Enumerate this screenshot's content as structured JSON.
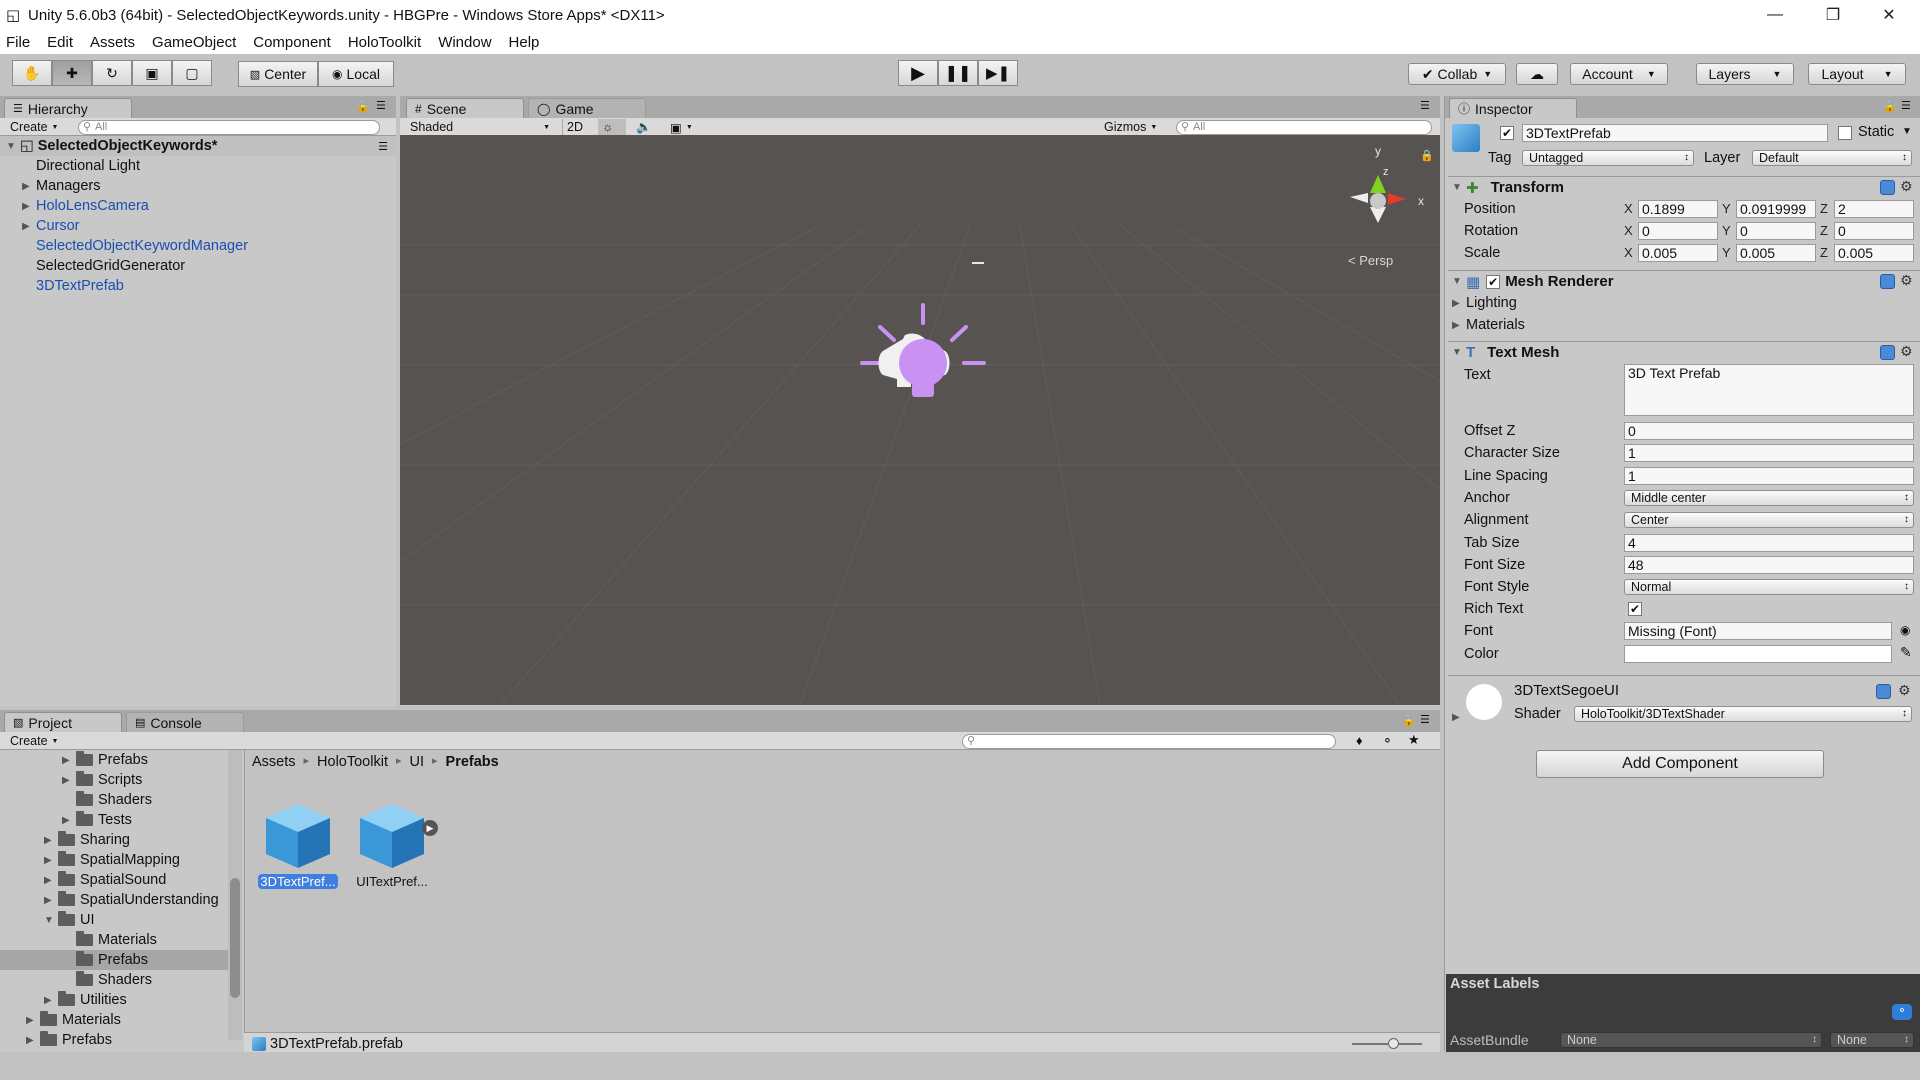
{
  "window": {
    "title": "Unity 5.6.0b3 (64bit) - SelectedObjectKeywords.unity - HBGPre - Windows Store Apps* <DX11>"
  },
  "menu": [
    "File",
    "Edit",
    "Assets",
    "GameObject",
    "Component",
    "HoloToolkit",
    "Window",
    "Help"
  ],
  "toolbar": {
    "pivot": "Center",
    "space": "Local",
    "collab": "Collab",
    "account": "Account",
    "layers": "Layers",
    "layout": "Layout"
  },
  "hierarchy": {
    "tab": "Hierarchy",
    "create": "Create",
    "search_placeholder": "All",
    "scene_name": "SelectedObjectKeywords*",
    "items": [
      {
        "label": "Directional Light",
        "expandable": false,
        "prefab": false
      },
      {
        "label": "Managers",
        "expandable": true,
        "prefab": false
      },
      {
        "label": "HoloLensCamera",
        "expandable": true,
        "prefab": true
      },
      {
        "label": "Cursor",
        "expandable": true,
        "prefab": true
      },
      {
        "label": "SelectedObjectKeywordManager",
        "expandable": false,
        "prefab": true
      },
      {
        "label": "SelectedGridGenerator",
        "expandable": false,
        "prefab": false
      },
      {
        "label": "3DTextPrefab",
        "expandable": false,
        "prefab": true
      }
    ]
  },
  "scene": {
    "tab_scene": "Scene",
    "tab_game": "Game",
    "shading": "Shaded",
    "mode_2d": "2D",
    "gizmos": "Gizmos",
    "search_placeholder": "All",
    "persp": "Persp",
    "axis_x": "x",
    "axis_y": "y",
    "axis_z": "z"
  },
  "inspector": {
    "tab": "Inspector",
    "object_name": "3DTextPrefab",
    "static_label": "Static",
    "tag_label": "Tag",
    "tag_value": "Untagged",
    "layer_label": "Layer",
    "layer_value": "Default",
    "transform": {
      "title": "Transform",
      "rows": [
        {
          "label": "Position",
          "x": "0.1899",
          "y": "0.0919999",
          "z": "2"
        },
        {
          "label": "Rotation",
          "x": "0",
          "y": "0",
          "z": "0"
        },
        {
          "label": "Scale",
          "x": "0.005",
          "y": "0.005",
          "z": "0.005"
        }
      ]
    },
    "mesh_renderer": {
      "title": "Mesh Renderer",
      "lighting": "Lighting",
      "materials": "Materials"
    },
    "text_mesh": {
      "title": "Text Mesh",
      "text_label": "Text",
      "text_value": "3D Text Prefab",
      "rows": [
        {
          "label": "Offset Z",
          "value": "0",
          "kind": "field"
        },
        {
          "label": "Character Size",
          "value": "1",
          "kind": "field"
        },
        {
          "label": "Line Spacing",
          "value": "1",
          "kind": "field"
        },
        {
          "label": "Anchor",
          "value": "Middle center",
          "kind": "popup"
        },
        {
          "label": "Alignment",
          "value": "Center",
          "kind": "popup"
        },
        {
          "label": "Tab Size",
          "value": "4",
          "kind": "field"
        },
        {
          "label": "Font Size",
          "value": "48",
          "kind": "field"
        },
        {
          "label": "Font Style",
          "value": "Normal",
          "kind": "popup"
        }
      ],
      "rich_text_label": "Rich Text",
      "rich_text": true,
      "font_label": "Font",
      "font_value": "Missing (Font)",
      "color_label": "Color",
      "color_value": "#ffffff"
    },
    "material": {
      "name": "3DTextSegoeUI",
      "shader_label": "Shader",
      "shader_value": "HoloToolkit/3DTextShader"
    },
    "add_component": "Add Component",
    "asset_labels": "Asset Labels",
    "asset_bundle_label": "AssetBundle",
    "asset_bundle_value": "None",
    "asset_bundle_variant": "None"
  },
  "project": {
    "tab_project": "Project",
    "tab_console": "Console",
    "create": "Create",
    "tree": [
      {
        "label": "Prefabs",
        "depth": 3,
        "expandable": true
      },
      {
        "label": "Scripts",
        "depth": 3,
        "expandable": true
      },
      {
        "label": "Shaders",
        "depth": 3,
        "expandable": false
      },
      {
        "label": "Tests",
        "depth": 3,
        "expandable": true
      },
      {
        "label": "Sharing",
        "depth": 2,
        "expandable": true
      },
      {
        "label": "SpatialMapping",
        "depth": 2,
        "expandable": true
      },
      {
        "label": "SpatialSound",
        "depth": 2,
        "expandable": true
      },
      {
        "label": "SpatialUnderstanding",
        "depth": 2,
        "expandable": true
      },
      {
        "label": "UI",
        "depth": 2,
        "expandable": true,
        "open": true
      },
      {
        "label": "Materials",
        "depth": 3,
        "expandable": false
      },
      {
        "label": "Prefabs",
        "depth": 3,
        "expandable": false,
        "selected": true
      },
      {
        "label": "Shaders",
        "depth": 3,
        "expandable": false
      },
      {
        "label": "Utilities",
        "depth": 2,
        "expandable": true
      },
      {
        "label": "Materials",
        "depth": 1,
        "expandable": true
      },
      {
        "label": "Prefabs",
        "depth": 1,
        "expandable": true
      }
    ],
    "breadcrumb": [
      "Assets",
      "HoloToolkit",
      "UI",
      "Prefabs"
    ],
    "assets": [
      {
        "label": "3DTextPref...",
        "selected": true
      },
      {
        "label": "UITextPref...",
        "selected": false
      }
    ],
    "status_file": "3DTextPrefab.prefab"
  }
}
